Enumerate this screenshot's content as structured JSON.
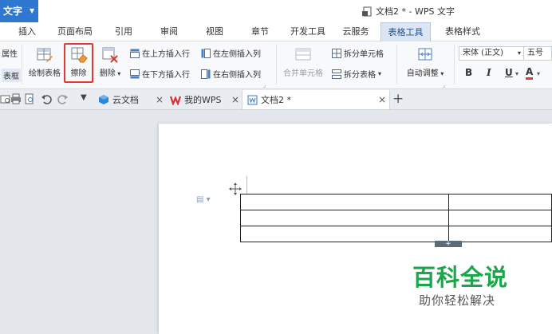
{
  "titlebar": {
    "app_label": "文字",
    "doc_title": "文档2 * - WPS 文字"
  },
  "menu": {
    "tabs": [
      {
        "label": "插入"
      },
      {
        "label": "页面布局"
      },
      {
        "label": "引用"
      },
      {
        "label": "审阅"
      },
      {
        "label": "视图"
      },
      {
        "label": "章节"
      },
      {
        "label": "开发工具"
      },
      {
        "label": "云服务"
      },
      {
        "label": "表格工具"
      },
      {
        "label": "表格样式"
      }
    ],
    "active_tab": "表格工具"
  },
  "ribbon": {
    "prop_cut": "属性",
    "border_cut": "表框",
    "draw_table": "绘制表格",
    "erase": "擦除",
    "delete": "删除",
    "insert_above": "在上方插入行",
    "insert_below": "在下方插入行",
    "insert_left": "在左侧插入列",
    "insert_right": "在右侧插入列",
    "merge_cells": "合并单元格",
    "split_cells": "拆分单元格",
    "split_table": "拆分表格",
    "auto_fit": "自动调整",
    "font_name": "宋体 (正文)",
    "font_size": "五号",
    "bold": "B",
    "italic": "I",
    "underline": "U",
    "font_color": "A"
  },
  "tabs": {
    "cloud_docs": "云文档",
    "my_wps": "我的WPS",
    "doc2": "文档2 *",
    "close": "×",
    "new": "+"
  },
  "watermark": {
    "main": "百科全说",
    "sub": "助你轻松解决"
  },
  "colors": {
    "accent": "#2f78d0",
    "highlight": "#e53935",
    "watermark": "#1aa64a"
  }
}
